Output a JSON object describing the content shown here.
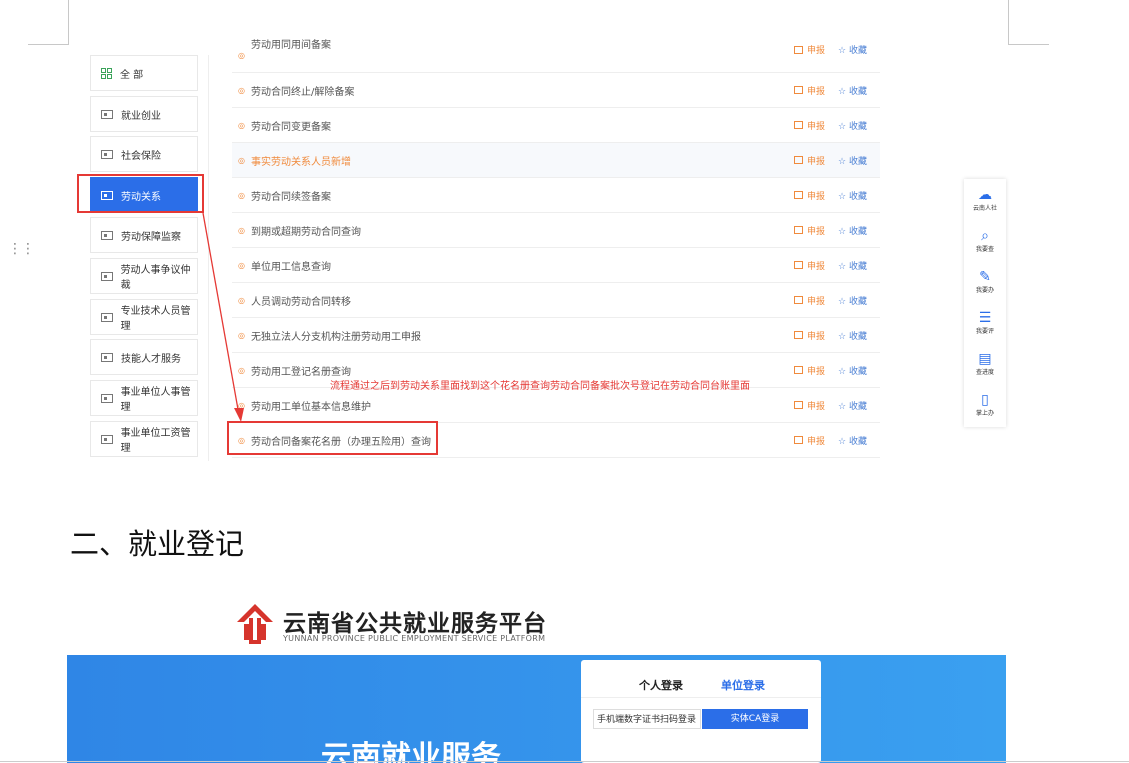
{
  "sidebar": {
    "items": [
      {
        "label": "全 部"
      },
      {
        "label": "就业创业"
      },
      {
        "label": "社会保险"
      },
      {
        "label": "劳动关系"
      },
      {
        "label": "劳动保障监察"
      },
      {
        "label": "劳动人事争议仲裁"
      },
      {
        "label": "专业技术人员管理"
      },
      {
        "label": "技能人才服务"
      },
      {
        "label": "事业单位人事管理"
      },
      {
        "label": "事业单位工资管理"
      }
    ]
  },
  "services": {
    "apply_label": "申报",
    "fav_label": "收藏",
    "rows": [
      {
        "label": "劳动用同用间备案"
      },
      {
        "label": "劳动合同终止/解除备案"
      },
      {
        "label": "劳动合同变更备案"
      },
      {
        "label": "事实劳动关系人员新增"
      },
      {
        "label": "劳动合同续签备案"
      },
      {
        "label": "到期或超期劳动合同查询"
      },
      {
        "label": "单位用工信息查询"
      },
      {
        "label": "人员调动劳动合同转移"
      },
      {
        "label": "无独立法人分支机构注册劳动用工申报"
      },
      {
        "label": "劳动用工登记名册查询"
      },
      {
        "label": "劳动用工单位基本信息维护"
      },
      {
        "label": "劳动合同备案花名册（办理五险用）查询"
      }
    ]
  },
  "right_bar": {
    "items": [
      {
        "label": "云南人社",
        "icon": "cloud-icon"
      },
      {
        "label": "我要查",
        "icon": "search-doc-icon"
      },
      {
        "label": "我要办",
        "icon": "handle-icon"
      },
      {
        "label": "我要评",
        "icon": "review-icon"
      },
      {
        "label": "查进度",
        "icon": "progress-icon"
      },
      {
        "label": "掌上办",
        "icon": "mobile-icon"
      }
    ]
  },
  "annotation": "流程通过之后到劳动关系里面找到这个花名册查询劳动合同备案批次号登记在劳动合同台账里面",
  "section_title": "二、就业登记",
  "platform": {
    "name": "云南省公共就业服务平台",
    "name_en": "YUNNAN PROVINCE PUBLIC EMPLOYMENT SERVICE PLATFORM",
    "banner_text": "云南就业服务",
    "login": {
      "tab_personal": "个人登录",
      "tab_unit": "单位登录",
      "scan_label": "手机端数字证书扫码登录",
      "ca_button": "实体CA登录"
    },
    "colors": {
      "brand_red": "#d6342c",
      "banner_blue": "#2f86e6",
      "button_blue": "#2b6ee8"
    }
  }
}
